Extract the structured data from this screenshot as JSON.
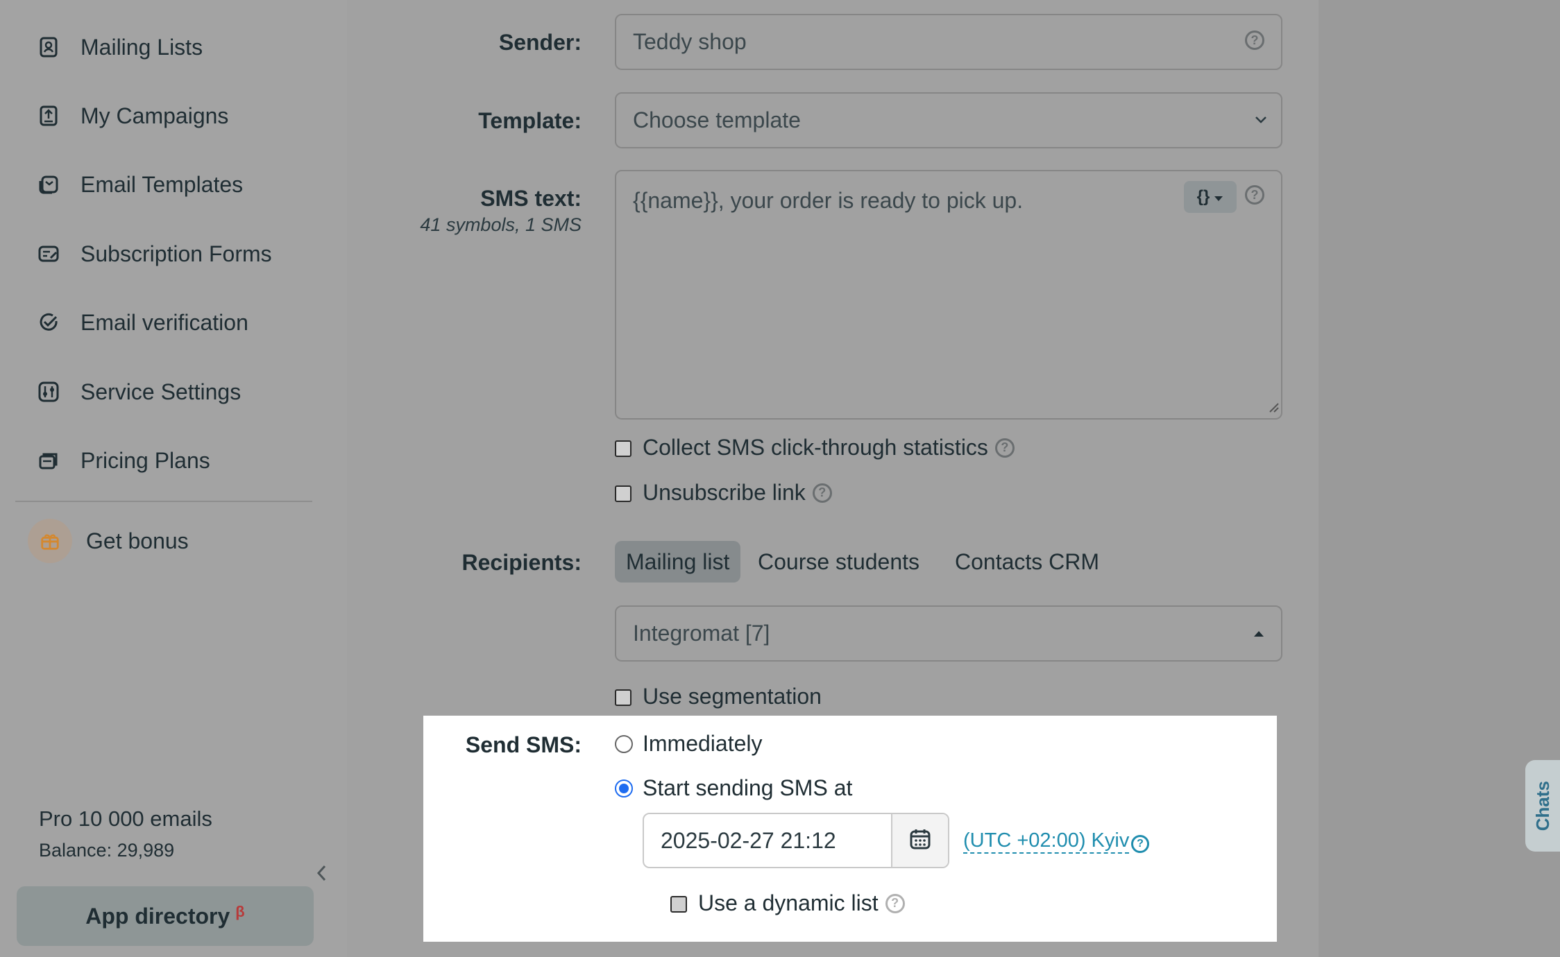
{
  "sidebar": {
    "items": [
      {
        "label": "Mailing Lists",
        "icon": "contact-list-icon"
      },
      {
        "label": "My Campaigns",
        "icon": "campaign-upload-icon"
      },
      {
        "label": "Email Templates",
        "icon": "email-template-icon"
      },
      {
        "label": "Subscription Forms",
        "icon": "subscription-form-icon"
      },
      {
        "label": "Email verification",
        "icon": "check-circle-icon"
      },
      {
        "label": "Service Settings",
        "icon": "settings-sliders-icon"
      },
      {
        "label": "Pricing Plans",
        "icon": "pricing-cards-icon"
      }
    ],
    "bonus_label": "Get bonus",
    "plan_name": "Pro 10 000 emails",
    "balance": "Balance: 29,989",
    "app_directory_label": "App directory",
    "app_directory_badge": "β"
  },
  "form": {
    "sender_label": "Sender:",
    "sender_value": "Teddy shop",
    "template_label": "Template:",
    "template_value": "Choose template",
    "sms_text_label": "SMS text:",
    "sms_text_meta": "41 symbols, 1 SMS",
    "sms_text_value": "{{name}}, your order is ready to pick up.",
    "variables_button": "{}",
    "collect_stats_label": "Collect SMS click-through statistics",
    "unsubscribe_label": "Unsubscribe link",
    "recipients_label": "Recipients:",
    "recipient_tabs": [
      "Mailing list",
      "Course students",
      "Contacts CRM"
    ],
    "mailing_list_value": "Integromat [7]",
    "segmentation_label": "Use segmentation",
    "send_label": "Send SMS:",
    "send_immediately": "Immediately",
    "send_scheduled": "Start sending SMS at",
    "send_mode": "scheduled",
    "datetime_value": "2025-02-27 21:12",
    "timezone_link": "(UTC +02:00) Kyiv",
    "dynamic_list_label": "Use a dynamic list"
  },
  "chats_label": "Chats",
  "colors": {
    "accent_blue": "#1e6cf0",
    "link": "#1f8dae",
    "badge_red": "#b73a3a"
  }
}
